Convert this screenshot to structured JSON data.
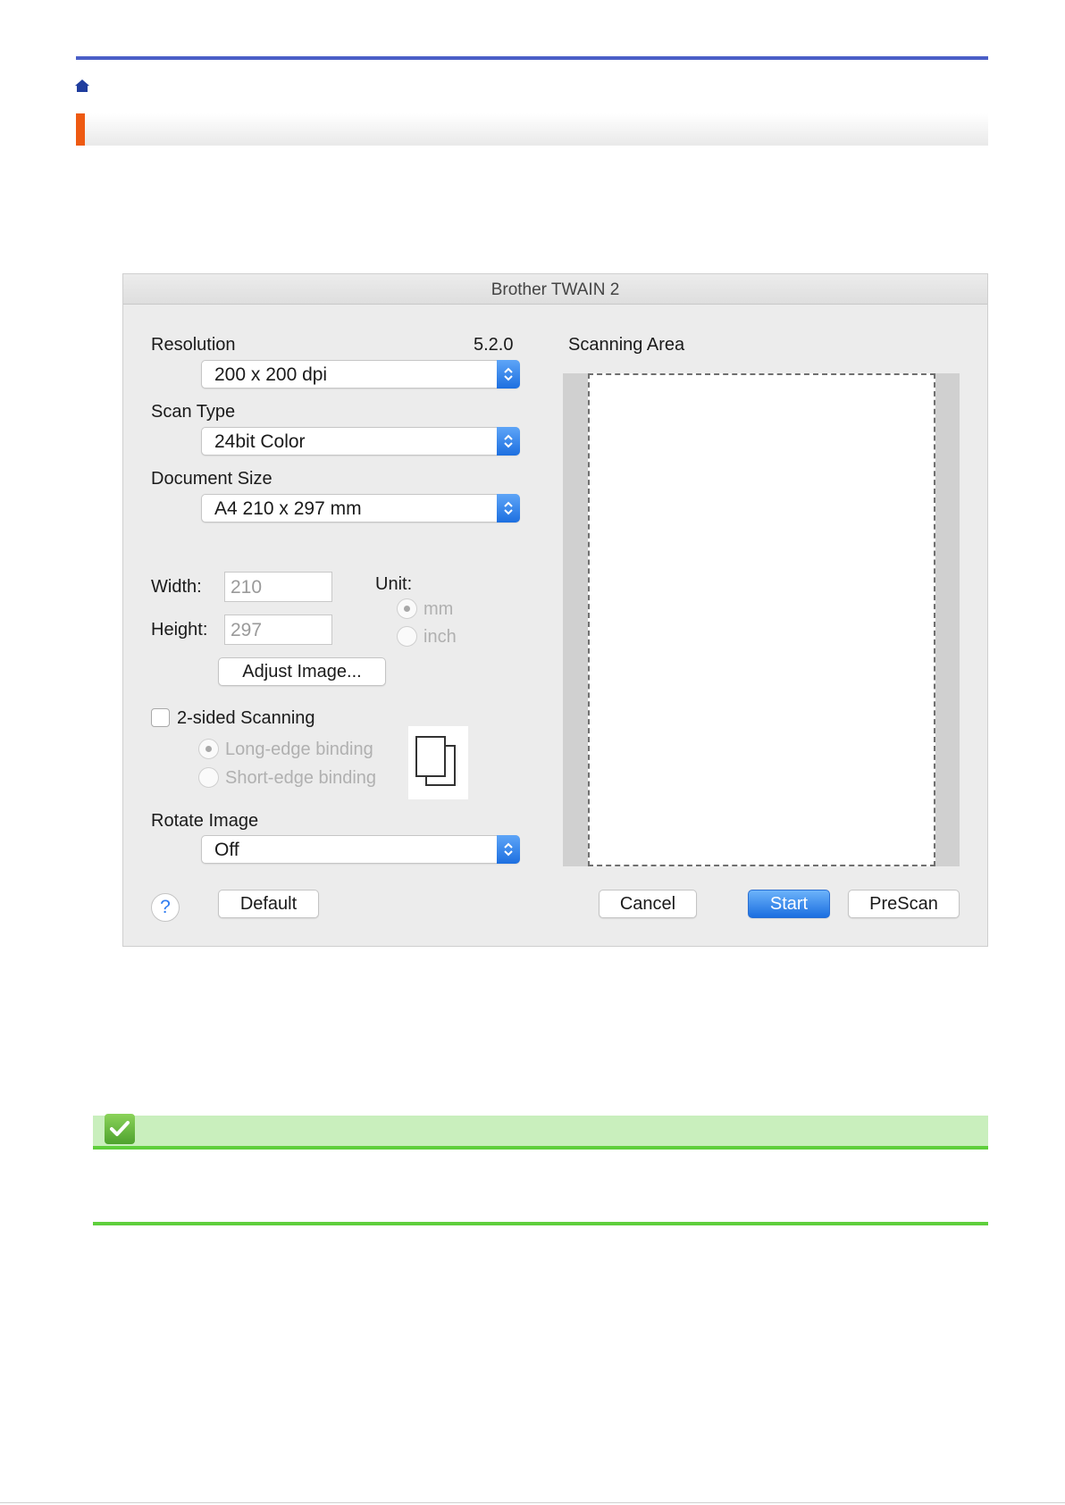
{
  "dialog": {
    "title": "Brother TWAIN 2",
    "version": "5.2.0",
    "resolution": {
      "label": "Resolution",
      "value": "200 x 200 dpi"
    },
    "scan_type": {
      "label": "Scan Type",
      "value": "24bit Color"
    },
    "document_size": {
      "label": "Document Size",
      "value": "A4  210 x 297 mm"
    },
    "width": {
      "label": "Width:",
      "value": "210"
    },
    "height": {
      "label": "Height:",
      "value": "297"
    },
    "unit": {
      "label": "Unit:",
      "options": [
        "mm",
        "inch"
      ],
      "selected": "mm"
    },
    "adjust_image_label": "Adjust Image...",
    "two_sided": {
      "label": "2-sided Scanning",
      "checked": false,
      "options": [
        "Long-edge binding",
        "Short-edge binding"
      ],
      "selected": "Long-edge binding"
    },
    "rotate_image": {
      "label": "Rotate Image",
      "value": "Off"
    },
    "scanning_area_label": "Scanning Area",
    "help_label": "?",
    "default_label": "Default",
    "cancel_label": "Cancel",
    "start_label": "Start",
    "prescan_label": "PreScan"
  },
  "colors": {
    "top_rule": "#4b5fc7",
    "section_accent": "#ee5a12",
    "primary_button": "#1b6ee0",
    "note_bar": "#c9efbd",
    "note_rule": "#5fcf3c"
  },
  "icons": {
    "home": "home-icon",
    "note": "checkmark-icon",
    "binding": "two-pages-icon",
    "popup": "up-down-chevron-icon"
  }
}
